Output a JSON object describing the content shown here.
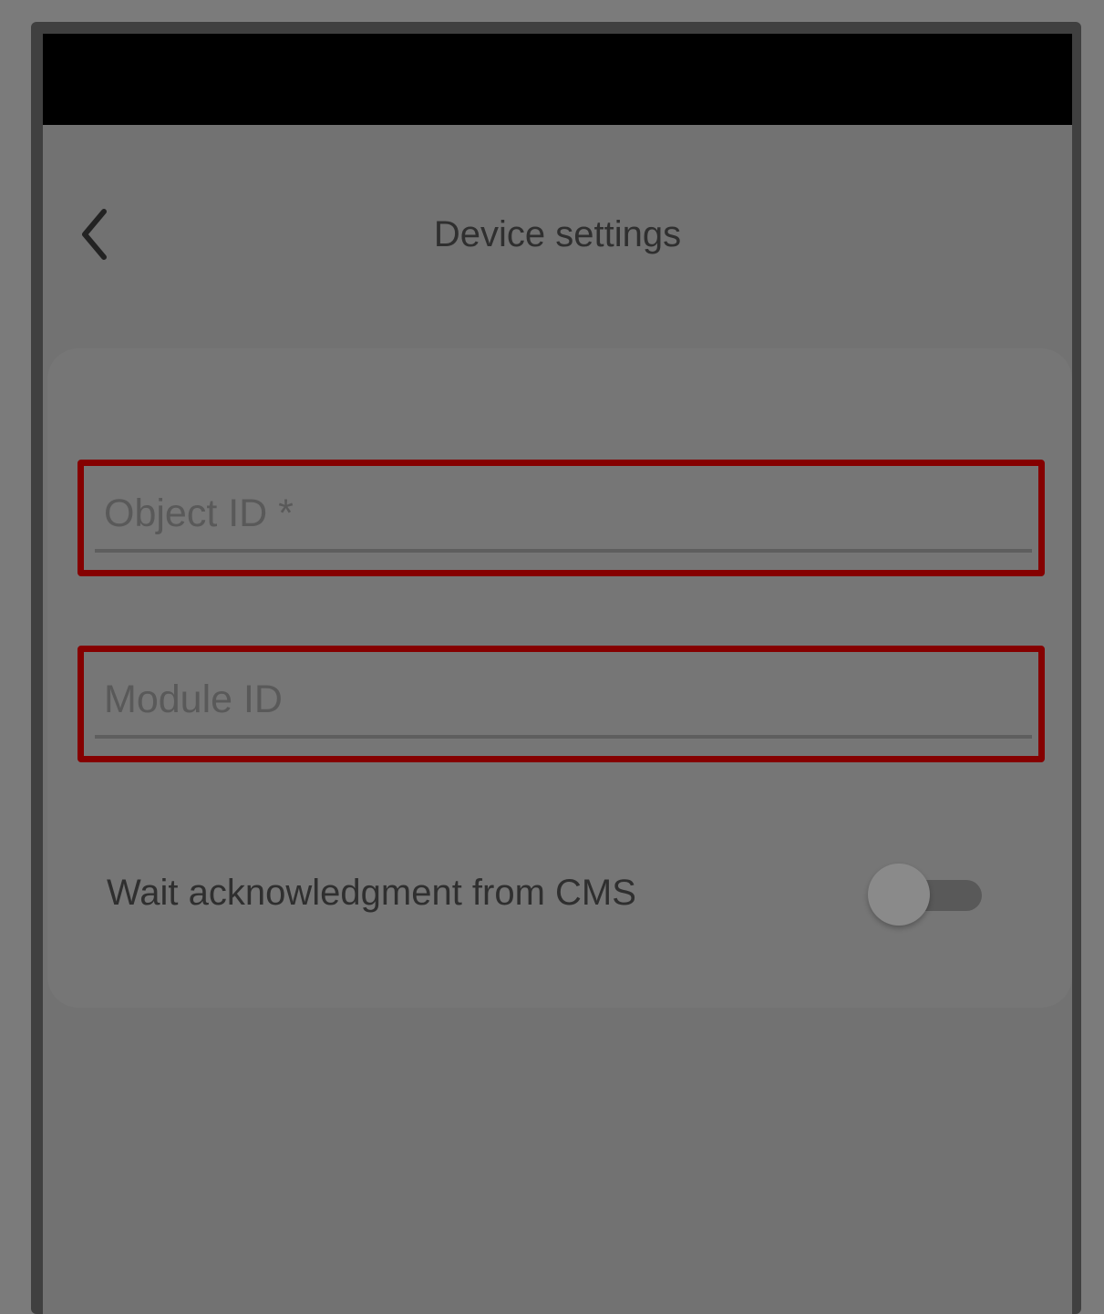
{
  "header": {
    "title": "Device settings",
    "back_icon": "chevron-left-icon"
  },
  "form": {
    "object_id": {
      "placeholder": "Object ID *",
      "value": ""
    },
    "module_id": {
      "placeholder": "Module ID",
      "value": ""
    },
    "wait_acknowledgment": {
      "label": "Wait acknowledgment from CMS",
      "enabled": false
    }
  },
  "colors": {
    "highlight_border": "#850000",
    "status_bar": "#000000"
  }
}
